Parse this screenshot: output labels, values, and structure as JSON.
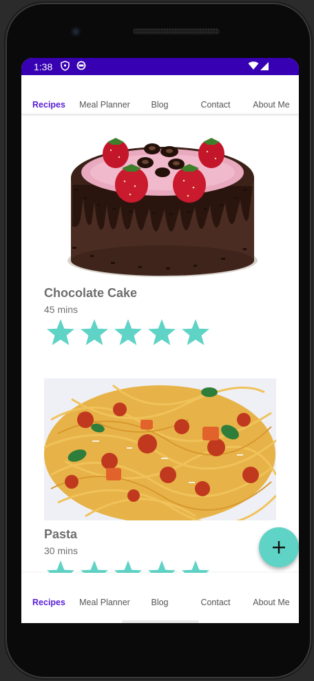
{
  "status_bar": {
    "time": "1:38",
    "background": "#3700b3",
    "icons": [
      "shield-icon",
      "sync-icon",
      "wifi-icon",
      "signal-icon"
    ]
  },
  "tabs": [
    {
      "label": "Recipes",
      "active": true
    },
    {
      "label": "Meal Planner",
      "active": false
    },
    {
      "label": "Blog",
      "active": false
    },
    {
      "label": "Contact",
      "active": false
    },
    {
      "label": "About Me",
      "active": false
    }
  ],
  "recipes": [
    {
      "title": "Chocolate Cake",
      "time": "45 mins",
      "rating": 5,
      "image": "chocolate-cake-image"
    },
    {
      "title": "Pasta",
      "time": "30 mins",
      "rating": 5,
      "image": "pasta-image"
    }
  ],
  "fab": {
    "icon": "plus-icon"
  },
  "colors": {
    "accent": "#5a1fd6",
    "star": "#5fd3c5",
    "fab": "#5fd3c5"
  }
}
